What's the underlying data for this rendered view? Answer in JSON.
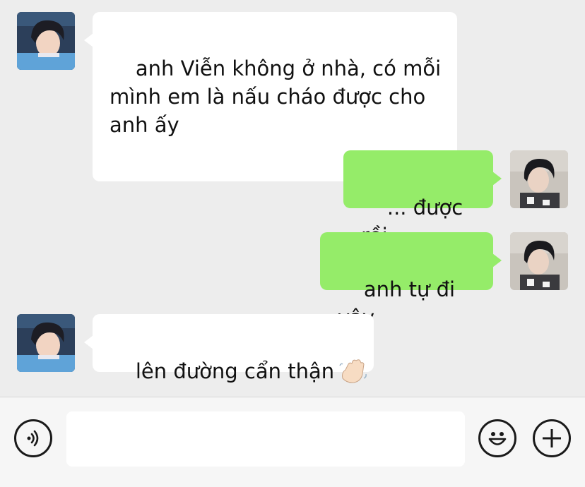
{
  "conversation": {
    "messages": [
      {
        "side": "incoming",
        "text": "anh Viễn không ở nhà, có mỗi\nmình em là nấu cháo được cho\nanh ấy"
      },
      {
        "side": "outgoing",
        "text": "... được rồi"
      },
      {
        "side": "outgoing",
        "text": "anh tự đi vậy"
      },
      {
        "side": "incoming",
        "text": "lên đường cẩn thận",
        "emoji": "waving-hand-icon"
      }
    ]
  },
  "input_bar": {
    "message_value": "",
    "voice_icon": "voice-icon",
    "emoji_icon": "emoji-smile-icon",
    "more_icon": "plus-icon"
  },
  "colors": {
    "chat_background": "#ededed",
    "incoming_bubble": "#ffffff",
    "outgoing_bubble": "#95ec69",
    "input_bar_background": "#f6f6f6"
  }
}
